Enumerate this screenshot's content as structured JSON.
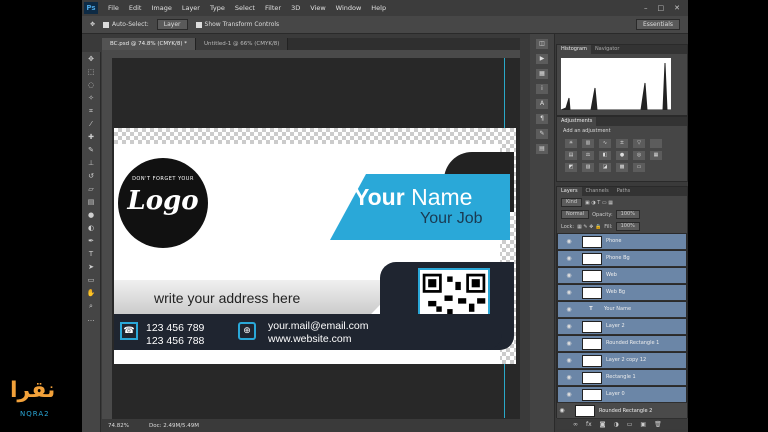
{
  "app": {
    "logo": "Ps",
    "menu": [
      "File",
      "Edit",
      "Image",
      "Layer",
      "Type",
      "Select",
      "Filter",
      "3D",
      "View",
      "Window",
      "Help"
    ],
    "window_buttons": [
      "–",
      "□",
      "✕"
    ]
  },
  "options_bar": {
    "auto_select_label": "Auto-Select:",
    "auto_select_value": "Layer",
    "transform_label": "Show Transform Controls",
    "workspace": "Essentials"
  },
  "tabs": [
    {
      "label": "BC.psd @ 74.8% (CMYK/8) *"
    },
    {
      "label": "Untitled-1 @ 66% (CMYK/8)"
    }
  ],
  "status": {
    "zoom": "74.82%",
    "doc": "Doc: 2.49M/5.49M"
  },
  "card": {
    "logo_top": "DON'T FORGET YOUR",
    "logo_main": "Logo",
    "name_first": "Your",
    "name_last": "Name",
    "job": "Your Job",
    "address": "write your address here",
    "phone1": "123 456 789",
    "phone2": "123 456 788",
    "email": "your.mail@email.com",
    "website": "www.website.com"
  },
  "panels": {
    "histogram_tabs": [
      "Histogram",
      "Navigator"
    ],
    "adjustments_tab": "Adjustments",
    "adjustments_label": "Add an adjustment",
    "layers_tabs": [
      "Layers",
      "Channels",
      "Paths"
    ],
    "kind": "Kind",
    "blend_mode": "Normal",
    "opacity_label": "Opacity:",
    "opacity_value": "100%",
    "lock_label": "Lock:",
    "fill_label": "Fill:",
    "fill_value": "100%"
  },
  "layers": [
    {
      "name": "Phone",
      "type": "shape",
      "selected": true
    },
    {
      "name": "Phone Bg",
      "type": "shape",
      "selected": true
    },
    {
      "name": "Web",
      "type": "shape",
      "selected": true
    },
    {
      "name": "Web Bg",
      "type": "shape",
      "selected": true
    },
    {
      "name": "Your Name",
      "type": "text",
      "selected": true
    },
    {
      "name": "Layer 2",
      "type": "shape",
      "selected": true
    },
    {
      "name": "Rounded Rectangle 1",
      "type": "shape",
      "selected": true
    },
    {
      "name": "Layer 2 copy 12",
      "type": "shape",
      "selected": true
    },
    {
      "name": "Rectangle 1",
      "type": "shape",
      "selected": true
    },
    {
      "name": "Layer 0",
      "type": "shape",
      "selected": true
    },
    {
      "name": "Rounded Rectangle 2",
      "type": "shape",
      "selected": false
    }
  ],
  "watermark": {
    "text": "نقرا",
    "sub": "NQRA2"
  }
}
